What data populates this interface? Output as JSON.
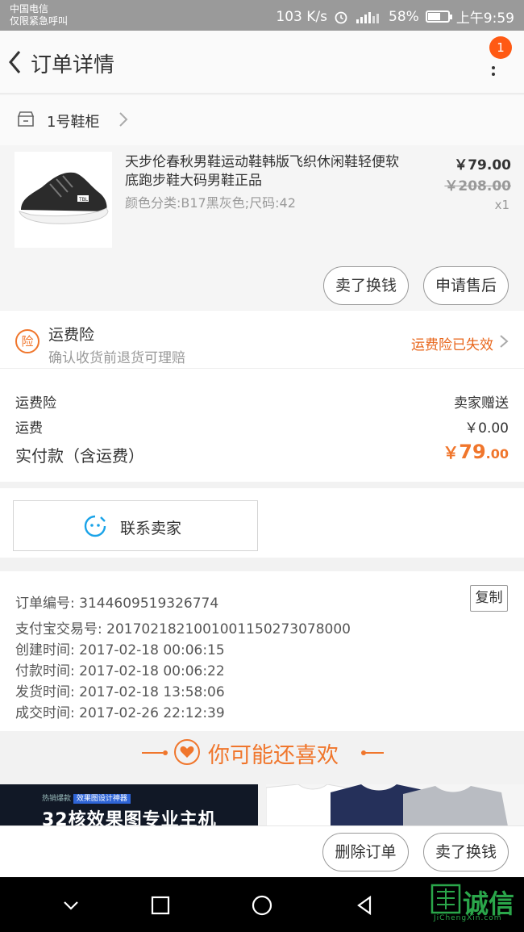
{
  "status_bar": {
    "carrier": "中国电信",
    "emergency": "仅限紧急呼叫",
    "speed": "103 K/s",
    "battery": "58%",
    "time": "上午9:59"
  },
  "header": {
    "title": "订单详情",
    "badge": "1"
  },
  "shop": {
    "name": "1号鞋柜"
  },
  "product": {
    "title": "天步伦春秋男鞋运动鞋韩版飞织休闲鞋轻便软底跑步鞋大码男鞋正品",
    "spec": "颜色分类:B17黑灰色;尺码:42",
    "price": "￥79.00",
    "original_price": "￥208.00",
    "quantity": "x1",
    "image_label": "TBL"
  },
  "item_actions": {
    "sell": "卖了换钱",
    "after_sale": "申请售后"
  },
  "insurance": {
    "icon_char": "险",
    "title": "运费险",
    "subtitle": "确认收货前退货可理赔",
    "status": "运费险已失效"
  },
  "costs": {
    "rows": [
      {
        "label": "运费险",
        "value": "卖家赠送"
      },
      {
        "label": "运费",
        "value": "￥0.00"
      }
    ],
    "total_label": "实付款（含运费）",
    "total_currency": "￥",
    "total_int": "79",
    "total_dec": ".00"
  },
  "contact": {
    "label": "联系卖家"
  },
  "order_info": {
    "copy": "复制",
    "rows": [
      "订单编号: 3144609519326774",
      "支付宝交易号: 2017021821001001150273078000",
      "创建时间: 2017-02-18 00:06:15",
      "付款时间: 2017-02-18 00:06:22",
      "发货时间: 2017-02-18 13:58:06",
      "成交时间: 2017-02-26 22:12:39"
    ]
  },
  "recommend": {
    "title": "你可能还喜欢",
    "ad_tag_prefix": "热销爆款",
    "ad_tag": "效果图设计神器",
    "ad_text": "32核效果图专业主机"
  },
  "bottom_actions": {
    "delete": "删除订单",
    "sell": "卖了换钱"
  },
  "watermark": {
    "text": "诚信",
    "sub": "JiChengXin.com"
  },
  "colors": {
    "accent": "#f0762c",
    "badge": "#ff5a14"
  }
}
